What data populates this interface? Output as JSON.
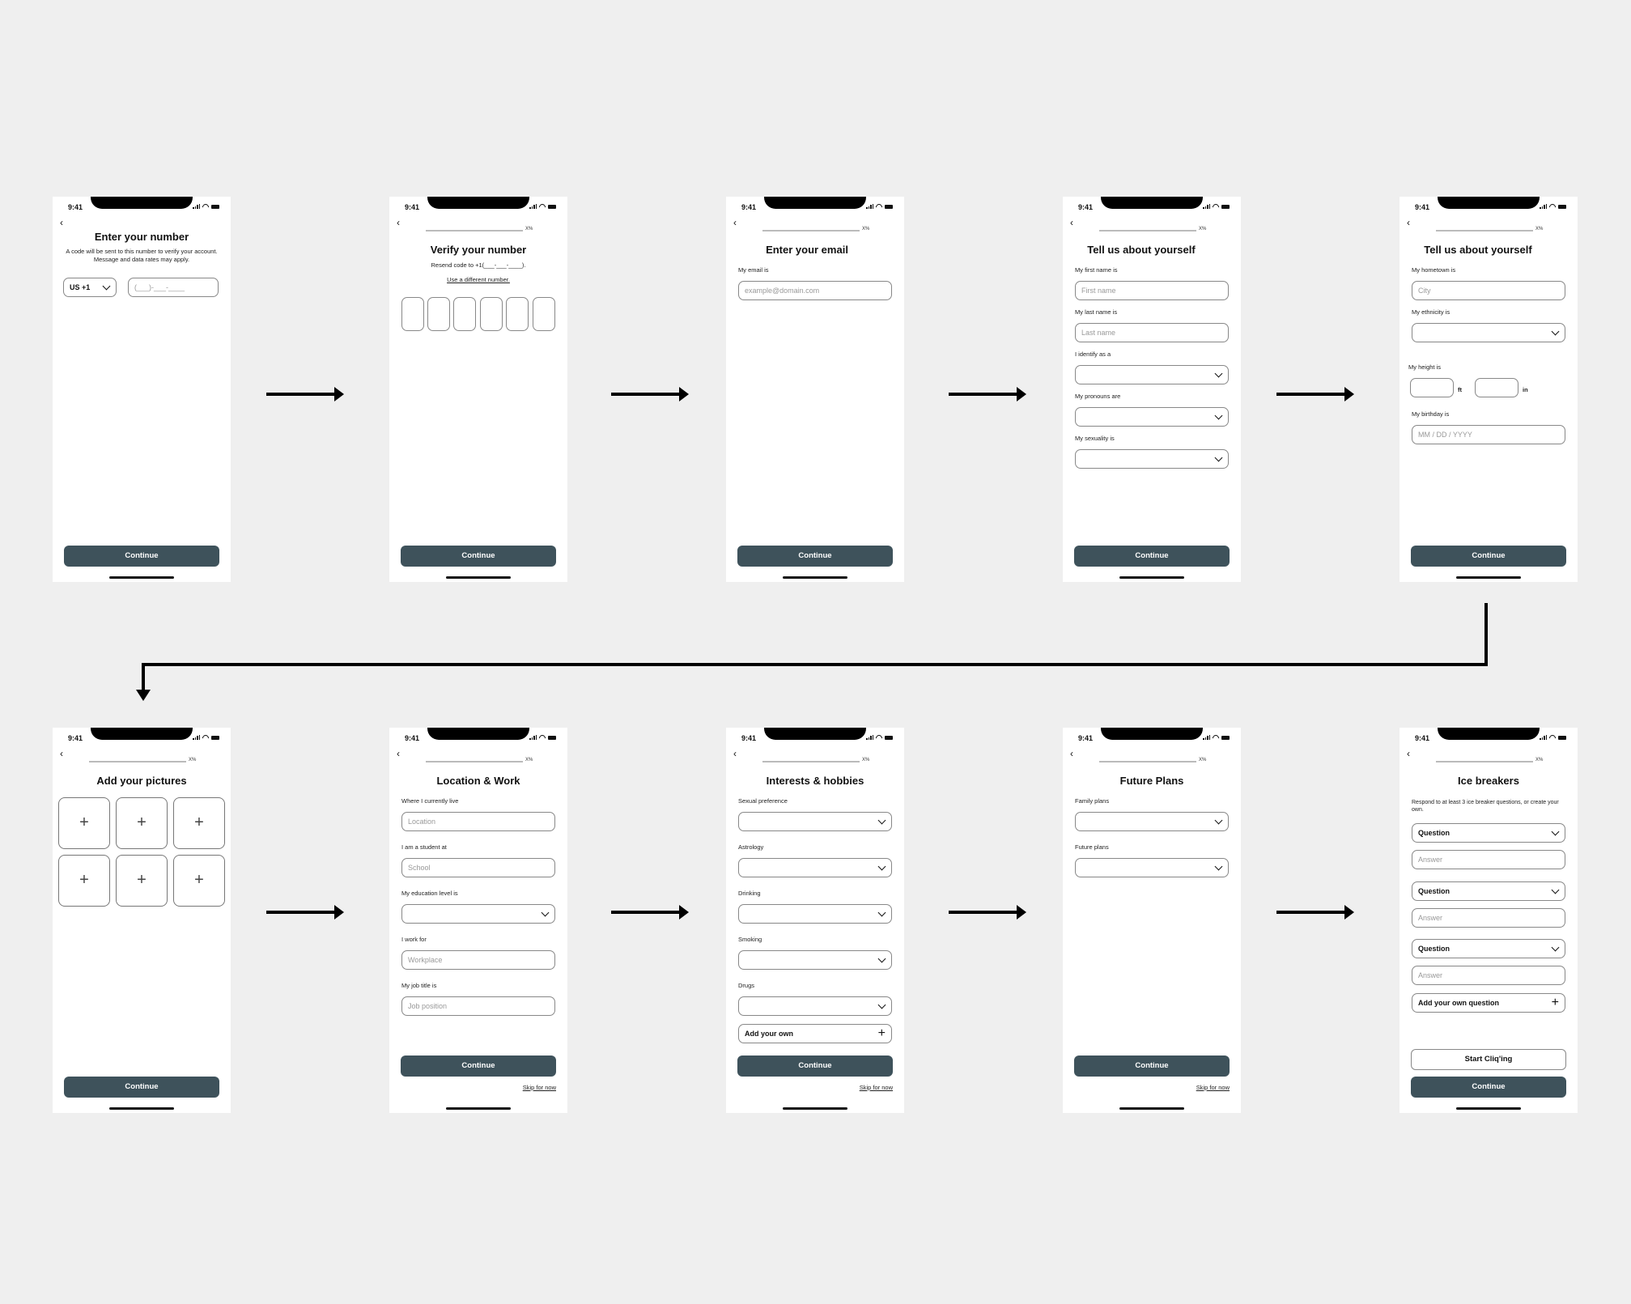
{
  "status_time": "9:41",
  "progress_label": "X%",
  "continue_label": "Continue",
  "skip_label": "Skip for now",
  "screens": {
    "phone": {
      "title": "Enter your number",
      "subtitle": "A code will be sent to this number to verify your account. Message and data rates may apply.",
      "country_code": "US +1",
      "phone_placeholder": "(___)-___-____"
    },
    "verify": {
      "title": "Verify your number",
      "resend_text": "Resend code to +1(___-___-____).",
      "different_number_link": "Use a different number."
    },
    "email": {
      "title": "Enter your email",
      "label": "My email is",
      "placeholder": "example@domain.com"
    },
    "about1": {
      "title": "Tell us about yourself",
      "first_label": "My first name is",
      "first_placeholder": "First name",
      "last_label": "My last name is",
      "last_placeholder": "Last name",
      "identify_label": "I identify as a",
      "pronouns_label": "My pronouns are",
      "sexuality_label": "My sexuality is"
    },
    "about2": {
      "title": "Tell us about yourself",
      "hometown_label": "My hometown is",
      "hometown_placeholder": "City",
      "ethnicity_label": "My ethnicity is",
      "height_label": "My height is",
      "ft_unit": "ft",
      "in_unit": "in",
      "birthday_label": "My birthday is",
      "birthday_placeholder": "MM / DD / YYYY"
    },
    "pictures": {
      "title": "Add your pictures",
      "slot_icon": "+"
    },
    "location": {
      "title": "Location & Work",
      "live_label": "Where I currently live",
      "live_placeholder": "Location",
      "student_label": "I am a student at",
      "student_placeholder": "School",
      "education_label": "My education level is",
      "work_label": "I work for",
      "work_placeholder": "Workplace",
      "job_label": "My job title is",
      "job_placeholder": "Job position"
    },
    "interests": {
      "title": "Interests & hobbies",
      "labels": [
        "Sexual preference",
        "Astrology",
        "Drinking",
        "Smoking",
        "Drugs"
      ],
      "add_own": "Add your own"
    },
    "future": {
      "title": "Future Plans",
      "family_label": "Family plans",
      "future_label": "Future plans"
    },
    "icebreakers": {
      "title": "Ice breakers",
      "subtitle": "Respond to at least 3 ice breaker questions, or create your own.",
      "question_label": "Question",
      "answer_placeholder": "Answer",
      "add_question": "Add your own question",
      "start_button": "Start Cliq'ing"
    }
  }
}
